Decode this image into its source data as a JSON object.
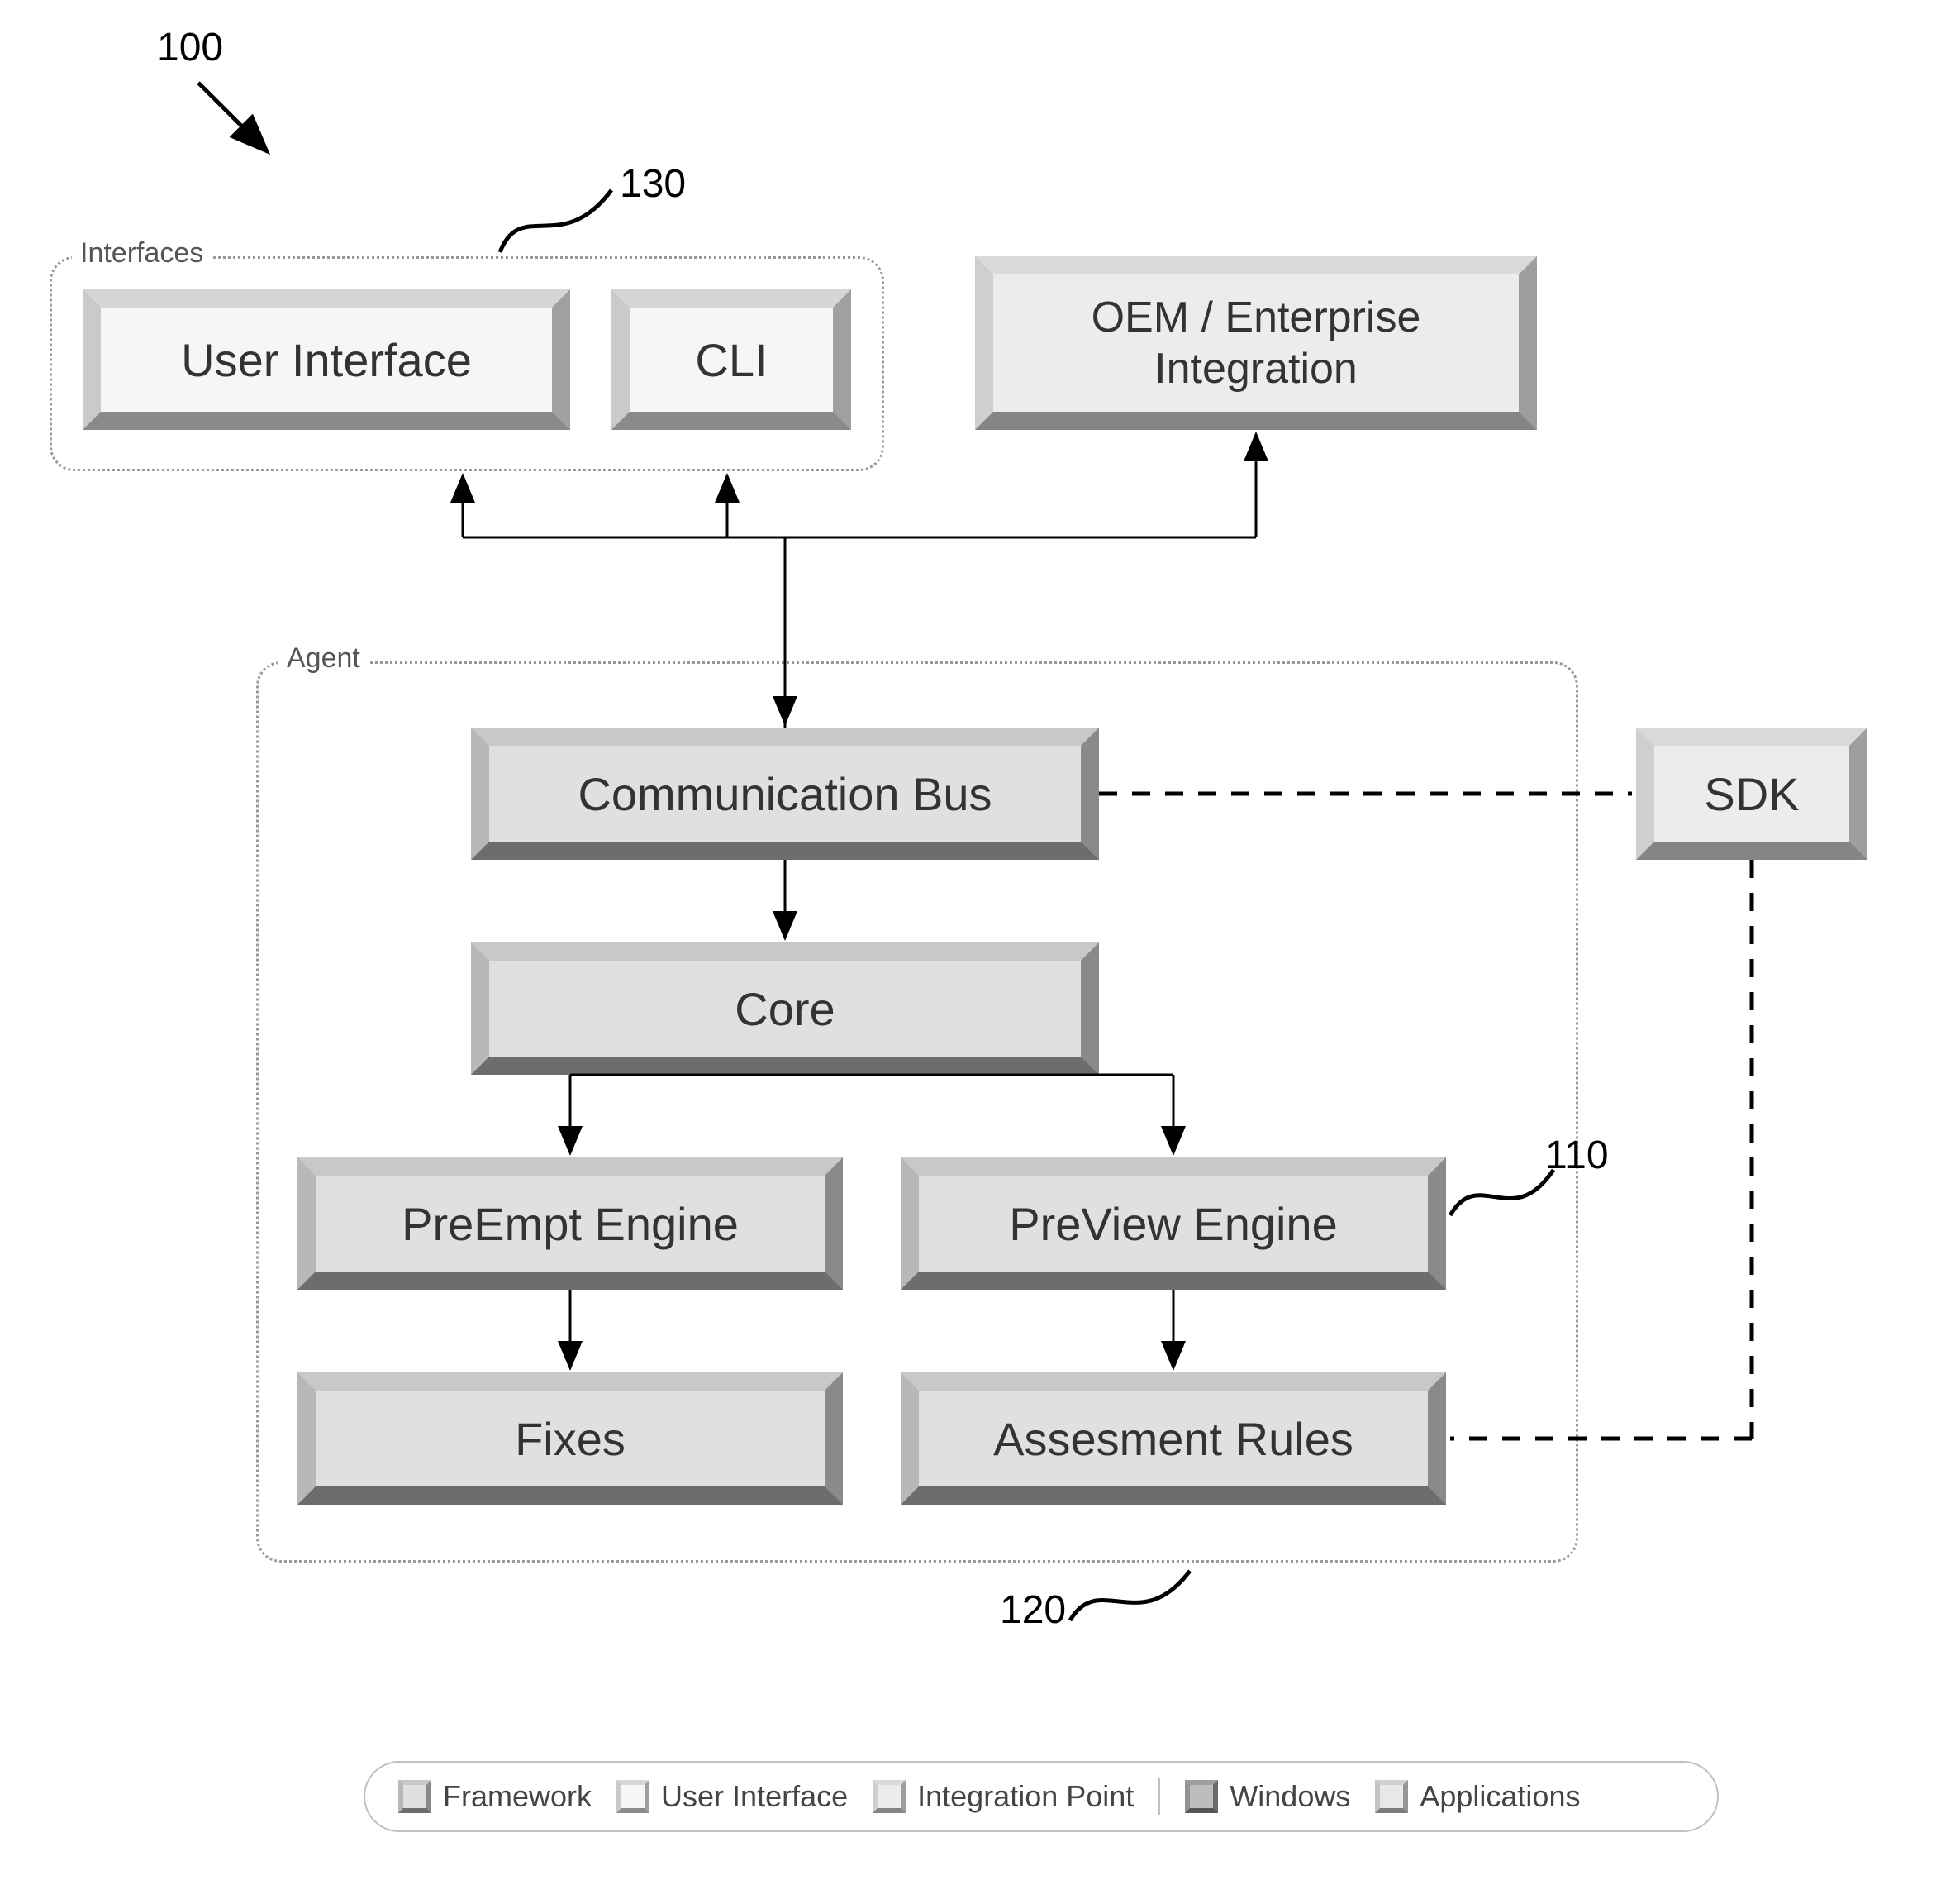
{
  "refs": {
    "r100": "100",
    "r130": "130",
    "r110": "110",
    "r120": "120"
  },
  "groups": {
    "interfaces_label": "Interfaces",
    "agent_label": "Agent"
  },
  "blocks": {
    "user_interface": "User Interface",
    "cli": "CLI",
    "oem": "OEM / Enterprise Integration",
    "comm_bus": "Communication Bus",
    "sdk": "SDK",
    "core": "Core",
    "preempt": "PreEmpt Engine",
    "preview": "PreView Engine",
    "fixes": "Fixes",
    "assessment_rules": "Assesment Rules"
  },
  "legend": {
    "framework": "Framework",
    "ui": "User Interface",
    "integration": "Integration Point",
    "windows": "Windows",
    "applications": "Applications"
  }
}
